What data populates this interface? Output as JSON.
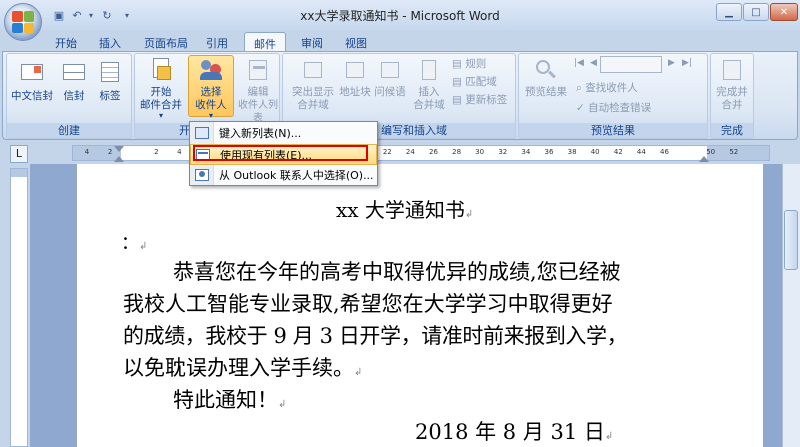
{
  "window": {
    "title": "xx大学录取通知书 - Microsoft Word"
  },
  "tabs": [
    "开始",
    "插入",
    "页面布局",
    "引用",
    "邮件",
    "审阅",
    "视图"
  ],
  "active_tab": "邮件",
  "ribbon": {
    "create": {
      "label": "创建",
      "buttons": [
        "中文信封",
        "信封",
        "标签"
      ]
    },
    "start_merge": {
      "label": "开始邮件合并",
      "label_visible": "开",
      "start_btn": [
        "开始",
        "邮件合并"
      ],
      "select_btn": [
        "选择",
        "收件人"
      ],
      "edit_btn": [
        "编辑",
        "收件人列表"
      ]
    },
    "write_insert": {
      "label": "编写和插入域",
      "label_visible": "编写和插入域",
      "buttons": [
        "突出显示",
        "合并域",
        "地址块",
        "问候语",
        "插入",
        "合并域"
      ],
      "small": [
        "规则",
        "匹配域",
        "更新标签"
      ]
    },
    "preview": {
      "label": "预览结果",
      "preview_btn": "预览结果",
      "small": [
        "查找收件人",
        "自动检查错误"
      ]
    },
    "finish": {
      "label": "完成",
      "btn": [
        "完成并",
        "合并"
      ]
    }
  },
  "dropdown": {
    "items": [
      {
        "label": "键入新列表(N)...",
        "icon": "new-list-icon"
      },
      {
        "label": "使用现有列表(E)...",
        "icon": "existing-list-icon"
      },
      {
        "label": "从 Outlook 联系人中选择(O)...",
        "icon": "outlook-contacts-icon"
      }
    ]
  },
  "ruler": {
    "ticks": [
      "4",
      "2",
      "",
      "2",
      "4",
      "6",
      "8",
      "10",
      "12",
      "14",
      "16",
      "18",
      "20",
      "22",
      "24",
      "26",
      "28",
      "30",
      "32",
      "34",
      "36",
      "38",
      "40",
      "42",
      "44",
      "46",
      "",
      "50",
      "52"
    ]
  },
  "document": {
    "title": "xx 大学通知书",
    "salutation": "：",
    "paragraph_lines": [
      "恭喜您在今年的高考中取得优异的成绩,您已经被",
      "我校人工智能专业录取,希望您在大学学习中取得更好",
      "的成绩，我校于 9 月 3 日开学，请准时前来报到入学，",
      "以免耽误办理入学手续。"
    ],
    "notice": "特此通知！",
    "date": "2018 年 8 月 31 日"
  },
  "colors": {
    "accent": "#15428b",
    "ribbon_bg": "#dbe6f4",
    "highlight": "#e00000",
    "hover": "#ffd97a"
  }
}
